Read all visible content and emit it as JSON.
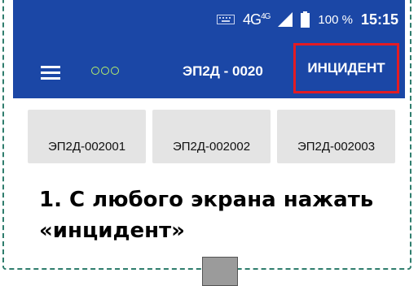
{
  "status_bar": {
    "network": "4G",
    "network_sup": "4G",
    "battery": "100 %",
    "time": "15:15",
    "icons": [
      "keyboard-icon",
      "signal-icon",
      "battery-icon"
    ]
  },
  "toolbar": {
    "title": "ЭП2Д - 0020",
    "incident_label": "ИНЦИДЕНТ",
    "icons": [
      "menu-icon",
      "dots-icon"
    ]
  },
  "tabs": [
    {
      "label": "ЭП2Д-002001"
    },
    {
      "label": "ЭП2Д-002002"
    },
    {
      "label": "ЭП2Д-002003"
    }
  ],
  "instruction": {
    "line1": "1. С любого экрана нажать",
    "line2": "«инцидент»"
  },
  "colors": {
    "appbar": "#1b47a6",
    "highlight": "#e31b23",
    "frame": "#2f7d6d",
    "dots": "#b6f06c"
  }
}
